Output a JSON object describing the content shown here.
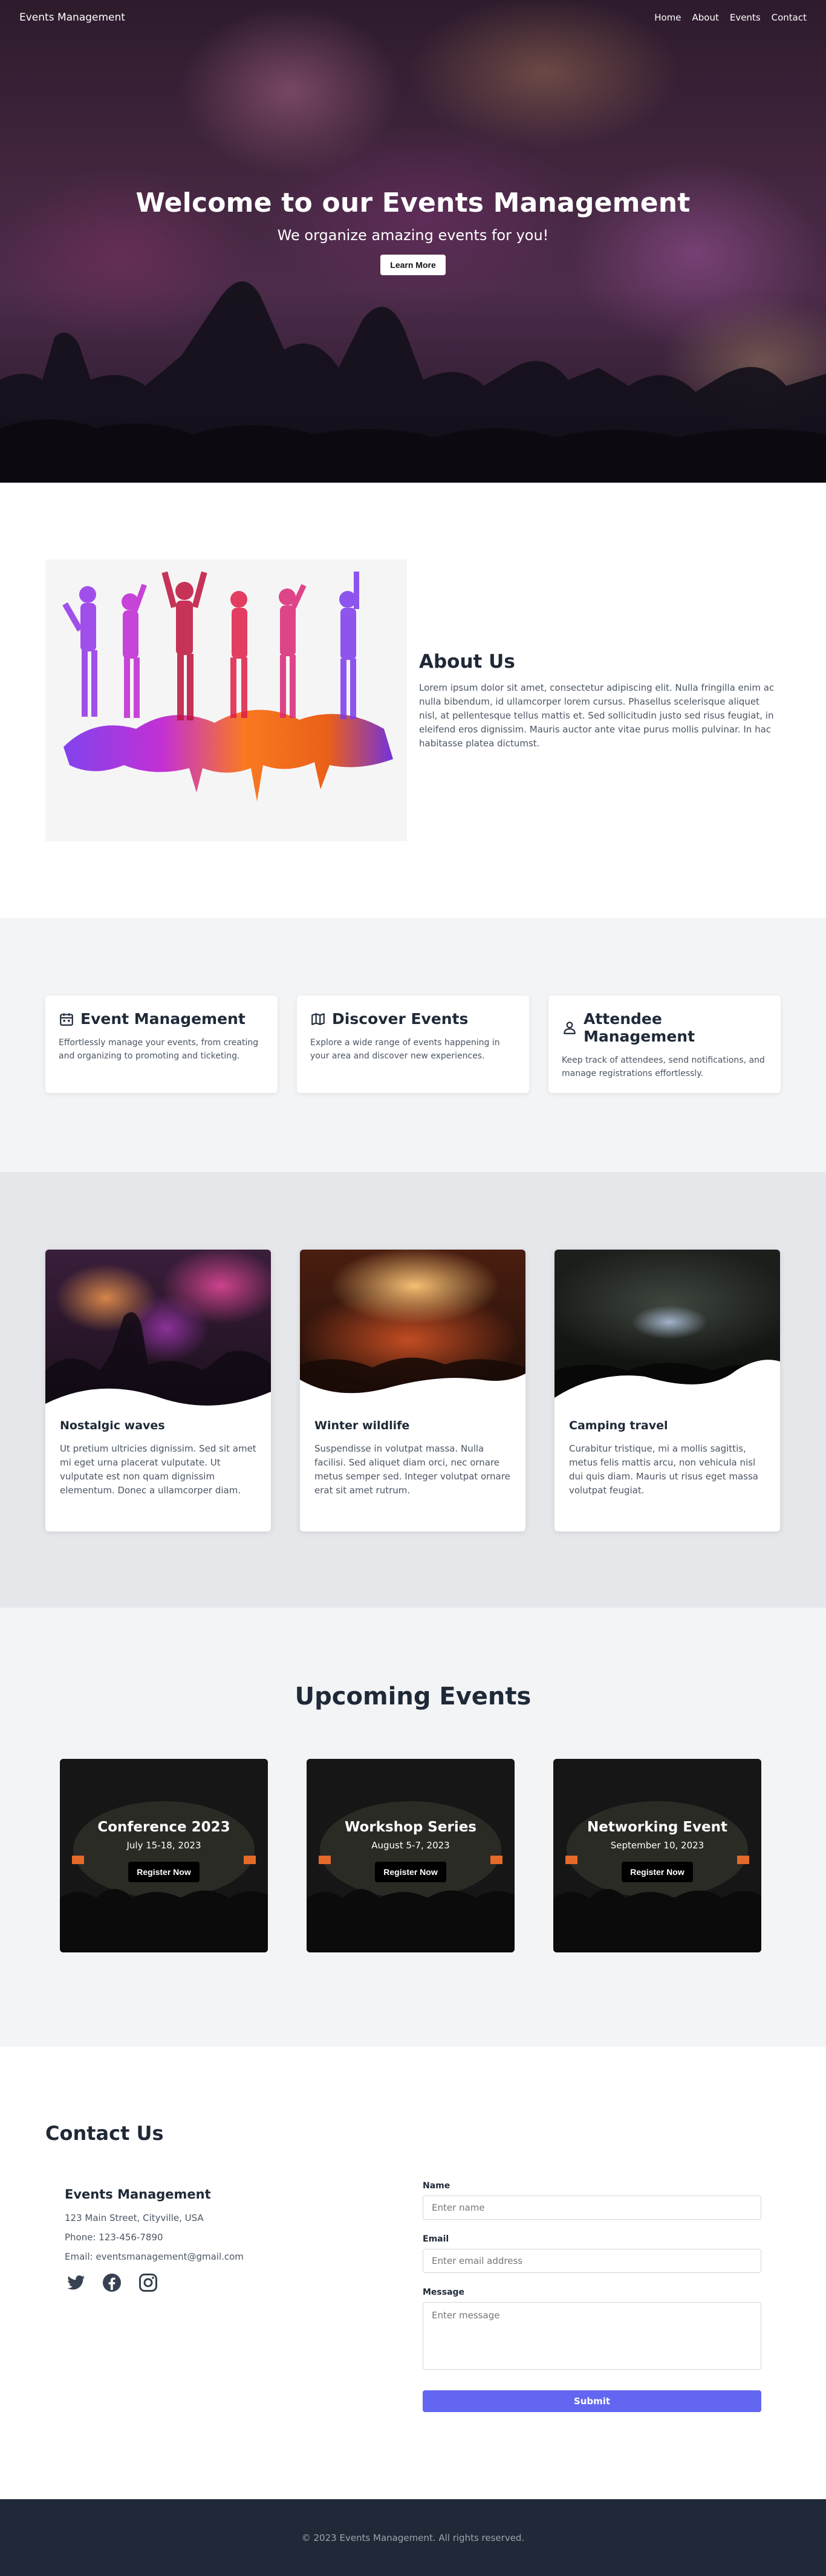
{
  "nav": {
    "brand": "Events Management",
    "links": [
      "Home",
      "About",
      "Events",
      "Contact"
    ]
  },
  "hero": {
    "title": "Welcome to our Events Management",
    "subtitle": "We organize amazing events for you!",
    "button": "Learn More"
  },
  "about": {
    "title": "About Us",
    "body": "Lorem ipsum dolor sit amet, consectetur adipiscing elit. Nulla fringilla enim ac nulla bibendum, id ullamcorper lorem cursus. Phasellus scelerisque aliquet nisl, at pellentesque tellus mattis et. Sed sollicitudin justo sed risus feugiat, in eleifend eros dignissim. Mauris auctor ante vitae purus mollis pulvinar. In hac habitasse platea dictumst."
  },
  "features": [
    {
      "icon": "calendar-icon",
      "title": "Event Management",
      "desc": "Effortlessly manage your events, from creating and organizing to promoting and ticketing."
    },
    {
      "icon": "map-icon",
      "title": "Discover Events",
      "desc": "Explore a wide range of events happening in your area and discover new experiences."
    },
    {
      "icon": "user-icon",
      "title": "Attendee Management",
      "desc": "Keep track of attendees, send notifications, and manage registrations effortlessly."
    }
  ],
  "wave_cards": [
    {
      "title": "Nostalgic waves",
      "body": "Ut pretium ultricies dignissim. Sed sit amet mi eget urna placerat vulputate. Ut vulputate est non quam dignissim elementum. Donec a ullamcorper diam."
    },
    {
      "title": "Winter wildlife",
      "body": "Suspendisse in volutpat massa. Nulla facilisi. Sed aliquet diam orci, nec ornare metus semper sed. Integer volutpat ornare erat sit amet rutrum."
    },
    {
      "title": "Camping travel",
      "body": "Curabitur tristique, mi a mollis sagittis, metus felis mattis arcu, non vehicula nisl dui quis diam. Mauris ut risus eget massa volutpat feugiat."
    }
  ],
  "upcoming": {
    "title": "Upcoming Events",
    "events": [
      {
        "title": "Conference 2023",
        "date": "July 15-18, 2023",
        "button": "Register Now"
      },
      {
        "title": "Workshop Series",
        "date": "August 5-7, 2023",
        "button": "Register Now"
      },
      {
        "title": "Networking Event",
        "date": "September 10, 2023",
        "button": "Register Now"
      }
    ]
  },
  "contact": {
    "title": "Contact Us",
    "org": "Events Management",
    "address": "123 Main Street, Cityville, USA",
    "phone": "Phone: 123-456-7890",
    "email": "Email: eventsmanagement@gmail.com",
    "form": {
      "name_label": "Name",
      "name_placeholder": "Enter name",
      "email_label": "Email",
      "email_placeholder": "Enter email address",
      "message_label": "Message",
      "message_placeholder": "Enter message",
      "submit": "Submit"
    }
  },
  "footer": {
    "text": "© 2023 Events Management. All rights reserved."
  },
  "colors": {
    "accent": "#6366f1",
    "footer_bg": "#1f2937",
    "section_gray": "#f3f4f6"
  }
}
